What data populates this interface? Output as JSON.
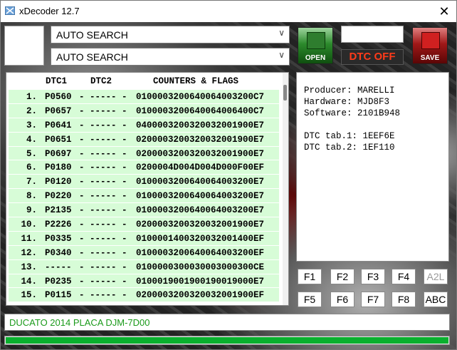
{
  "window": {
    "title": "xDecoder 12.7",
    "close_glyph": "✕"
  },
  "selectors": [
    {
      "value": "AUTO SEARCH"
    },
    {
      "value": "AUTO SEARCH"
    }
  ],
  "toolbar": {
    "open_label": "OPEN",
    "save_label": "SAVE",
    "dtc_off_label": "DTC OFF"
  },
  "table": {
    "headers": [
      "DTC1",
      "DTC2",
      "COUNTERS & FLAGS"
    ],
    "rows": [
      {
        "num": "1.",
        "dtc1": "P0560",
        "dtc2": "- ----- -",
        "flags": "0100003200640064003200C7"
      },
      {
        "num": "2.",
        "dtc1": "P0657",
        "dtc2": "- ----- -",
        "flags": "010000320064006400640 0C7"
      },
      {
        "num": "3.",
        "dtc1": "P0641",
        "dtc2": "- ----- -",
        "flags": "040000320032003200190 0E7"
      },
      {
        "num": "4.",
        "dtc1": "P0651",
        "dtc2": "- ----- -",
        "flags": "020000320032003200190 0E7"
      },
      {
        "num": "5.",
        "dtc1": "P0697",
        "dtc2": "- ----- -",
        "flags": "020000320032003200190 0E7"
      },
      {
        "num": "6.",
        "dtc1": "P0180",
        "dtc2": "- ----- -",
        "flags": "0200004D004D004D000F00EF"
      },
      {
        "num": "7.",
        "dtc1": "P0120",
        "dtc2": "- ----- -",
        "flags": "0100003200640064003200E7"
      },
      {
        "num": "8.",
        "dtc1": "P0220",
        "dtc2": "- ----- -",
        "flags": "0100003200640064003200E7"
      },
      {
        "num": "9.",
        "dtc1": "P2135",
        "dtc2": "- ----- -",
        "flags": "0100003200640064003200E7"
      },
      {
        "num": "10.",
        "dtc1": "P2226",
        "dtc2": "- ----- -",
        "flags": "0200003200320032001900E7"
      },
      {
        "num": "11.",
        "dtc1": "P0335",
        "dtc2": "- ----- -",
        "flags": "01000014003200320014 00EF"
      },
      {
        "num": "12.",
        "dtc1": "P0340",
        "dtc2": "- ----- -",
        "flags": "0100003200640064003200EF"
      },
      {
        "num": "13.",
        "dtc1": "-----",
        "dtc2": "- ----- -",
        "flags": "010000030003000300 0300CE"
      },
      {
        "num": "14.",
        "dtc1": "P0235",
        "dtc2": "- ----- -",
        "flags": "0100019001900190019000E7"
      },
      {
        "num": "15.",
        "dtc1": "P0115",
        "dtc2": "- ----- -",
        "flags": "0200003200320032001900EF"
      }
    ]
  },
  "info": {
    "producer": "Producer: MARELLI",
    "hardware": "Hardware: MJD8F3",
    "software": "Software: 2101B948",
    "dtc_tab1": "DTC tab.1: 1EEF6E",
    "dtc_tab2": "DTC tab.2: 1EF110"
  },
  "function_buttons": [
    "F1",
    "F2",
    "F3",
    "F4",
    "A2L",
    "F5",
    "F6",
    "F7",
    "F8",
    "ABC"
  ],
  "status": {
    "text": "DUCATO 2014 PLACA DJM-7D00"
  },
  "progress": {
    "value": 1.0
  },
  "colors": {
    "row_bg": "#d7fcd7",
    "status_text": "#1a9a1a",
    "dtc_off": "#ff3b1a",
    "progress_fill": "#09b02e"
  }
}
